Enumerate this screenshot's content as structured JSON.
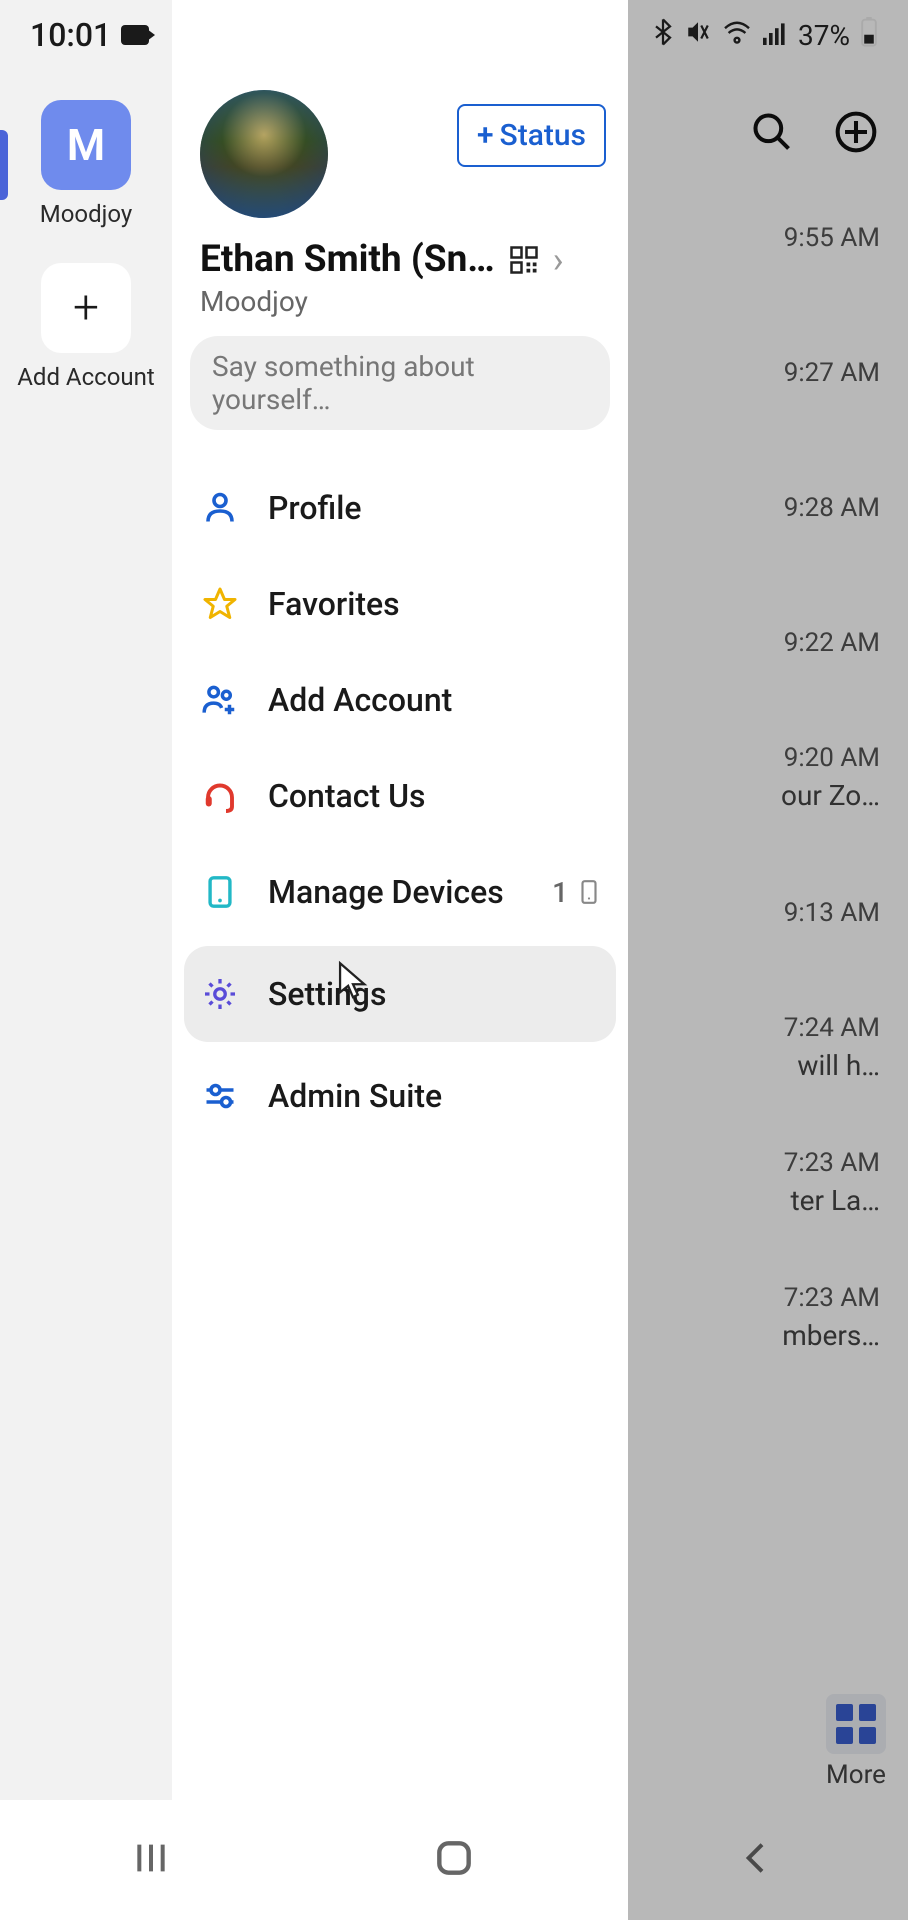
{
  "status_bar": {
    "time": "10:01",
    "battery_text": "37%"
  },
  "sidebar": {
    "workspace_letter": "M",
    "workspace_label": "Moodjoy",
    "add_account_label": "Add Account"
  },
  "drawer": {
    "status_button_label": "Status",
    "profile_name": "Ethan Smith (Sn…",
    "profile_workspace": "Moodjoy",
    "about_placeholder": "Say something about yourself…",
    "menu": {
      "profile": "Profile",
      "favorites": "Favorites",
      "add_account": "Add Account",
      "contact_us": "Contact Us",
      "manage_devices": "Manage Devices",
      "manage_devices_count": "1",
      "settings": "Settings",
      "admin_suite": "Admin Suite"
    }
  },
  "backdrop": {
    "rows": [
      {
        "time": "9:55 AM",
        "preview": ""
      },
      {
        "time": "9:27 AM",
        "preview": ""
      },
      {
        "time": "9:28 AM",
        "preview": ""
      },
      {
        "time": "9:22 AM",
        "preview": ""
      },
      {
        "time": "9:20 AM",
        "preview": "our Zo…"
      },
      {
        "time": "9:13 AM",
        "preview": ""
      },
      {
        "time": "7:24 AM",
        "preview": "will h…"
      },
      {
        "time": "7:23 AM",
        "preview": "ter La…"
      },
      {
        "time": "7:23 AM",
        "preview": "mbers…"
      }
    ],
    "more_label": "More"
  }
}
